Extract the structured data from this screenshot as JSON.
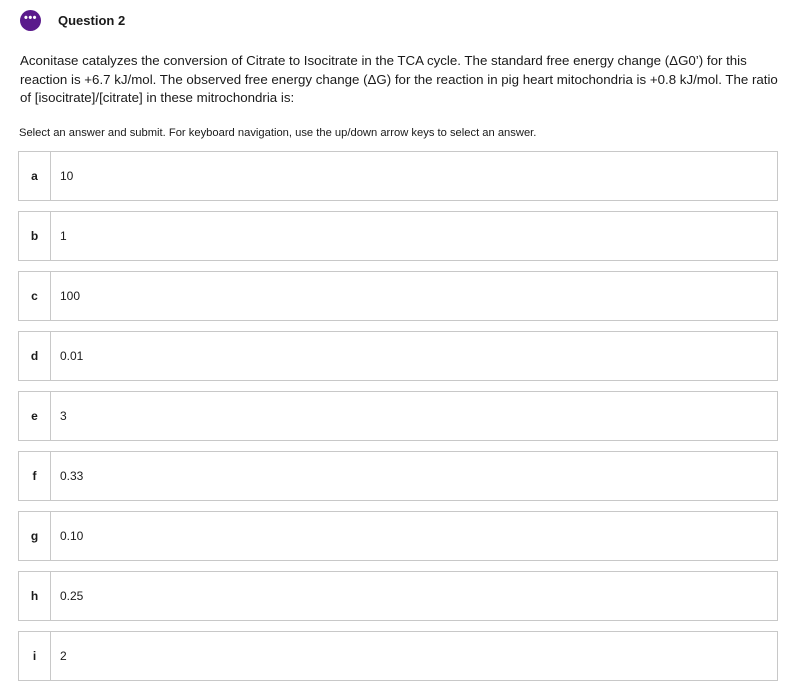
{
  "header": {
    "menu_icon": "ellipsis-icon",
    "menu_icon_glyph": "•••",
    "title": "Question 2",
    "accent_color": "#5a1a8c"
  },
  "question": {
    "text": "Aconitase catalyzes the conversion of Citrate to Isocitrate in the TCA cycle. The standard free energy change (ΔG0’) for this reaction is +6.7 kJ/mol. The observed free energy change (ΔG) for the reaction in pig heart mitochondria is +0.8 kJ/mol. The ratio of [isocitrate]/[citrate] in these mitrochondria is:"
  },
  "instructions": "Select an answer and submit. For keyboard navigation, use the up/down arrow keys to select an answer.",
  "options": [
    {
      "letter": "a",
      "value": "10"
    },
    {
      "letter": "b",
      "value": "1"
    },
    {
      "letter": "c",
      "value": "100"
    },
    {
      "letter": "d",
      "value": "0.01"
    },
    {
      "letter": "e",
      "value": "3"
    },
    {
      "letter": "f",
      "value": "0.33"
    },
    {
      "letter": "g",
      "value": "0.10"
    },
    {
      "letter": "h",
      "value": "0.25"
    },
    {
      "letter": "i",
      "value": "2"
    }
  ]
}
